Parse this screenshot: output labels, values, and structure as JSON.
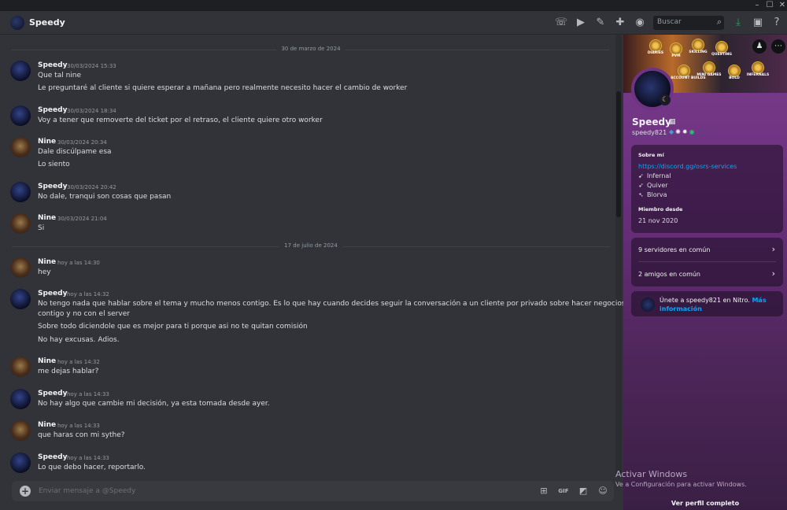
{
  "window": {
    "minimize": "–",
    "maximize": "☐",
    "close": "✕"
  },
  "header": {
    "title": "Speedy",
    "search_placeholder": "Buscar"
  },
  "dividers": [
    "30 de marzo de 2024",
    "17 de julio de 2024"
  ],
  "messages": [
    {
      "author": "Speedy",
      "time": "30/03/2024 15:33",
      "lines": [
        "Que tal nine",
        "Le preguntaré al cliente si quiere esperar a mañana pero realmente necesito hacer el cambio de worker"
      ]
    },
    {
      "author": "Speedy",
      "time": "30/03/2024 18:34",
      "lines": [
        "Voy a tener que removerte del ticket por el retraso, el cliente quiere otro worker"
      ]
    },
    {
      "author": "Nine",
      "time": "30/03/2024 20:34",
      "lines": [
        "Dale discúlpame esa",
        "Lo siento"
      ]
    },
    {
      "author": "Speedy",
      "time": "30/03/2024 20:42",
      "lines": [
        "No dale, tranqui son cosas que pasan"
      ]
    },
    {
      "author": "Nine",
      "time": "30/03/2024 21:04",
      "lines": [
        "Si"
      ]
    },
    {
      "author": "Nine",
      "time": "hoy a las 14:30",
      "lines": [
        "hey"
      ]
    },
    {
      "author": "Speedy",
      "time": "hoy a las 14:32",
      "lines": [
        "No tengo nada que hablar sobre el tema y mucho menos contigo. Es lo que hay cuando decides seguir la conversación a un cliente por privado sobre hacer negocios",
        "contigo y no con el server",
        "Sobre todo diciendole que es mejor para ti porque asi no te quitan comisión",
        "No hay excusas. Adios."
      ]
    },
    {
      "author": "Nine",
      "time": "hoy a las 14:32",
      "lines": [
        "me dejas hablar?"
      ]
    },
    {
      "author": "Speedy",
      "time": "hoy a las 14:33",
      "lines": [
        "No hay algo que cambie mi decisión, ya esta tomada desde ayer."
      ]
    },
    {
      "author": "Nine",
      "time": "hoy a las 14:33",
      "lines": [
        "que haras con mi sythe?"
      ]
    },
    {
      "author": "Speedy",
      "time": "hoy a las 14:33",
      "lines": [
        "Lo que debo hacer, reportarlo."
      ]
    }
  ],
  "composer": {
    "placeholder": "Enviar mensaje a @Speedy",
    "gif_label": "GIF"
  },
  "profile": {
    "badges": [
      "DIARIES",
      "PVM",
      "SKILLING",
      "QUESTING",
      "ACCOUNT BUILDS",
      "MINI GAMES",
      "BOLD",
      "INFERNALS"
    ],
    "name": "Speedy",
    "username": "speedy821",
    "about_title": "Sobre mí",
    "about_link": "https://discord.gg/osrs-services",
    "about_items": [
      "Infernal",
      "Quiver",
      "Blorva"
    ],
    "member_since_title": "Miembro desde",
    "member_since": "21 nov 2020",
    "mutual_servers": "9 servidores en común",
    "mutual_friends": "2 amigos en común",
    "nitro_text": "Únete a speedy821 en Nitro.",
    "nitro_link": "Más información",
    "full_profile": "Ver perfil completo"
  },
  "watermark": {
    "title": "Activar Windows",
    "subtitle": "Ve a Configuración para activar Windows."
  }
}
